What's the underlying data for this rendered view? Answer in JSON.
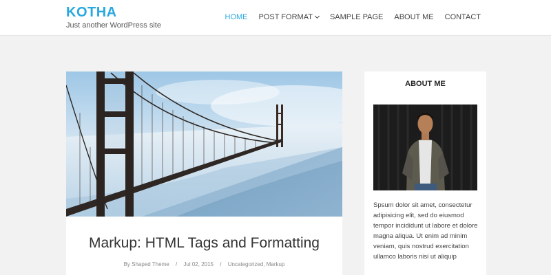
{
  "header": {
    "site_title": "KOTHA",
    "tagline": "Just another WordPress site",
    "nav": [
      {
        "label": "HOME",
        "active": true
      },
      {
        "label": "POST FORMAT",
        "dropdown": true
      },
      {
        "label": "SAMPLE PAGE"
      },
      {
        "label": "ABOUT ME"
      },
      {
        "label": "CONTACT"
      }
    ]
  },
  "post": {
    "title": "Markup: HTML Tags and Formatting",
    "author": "By Shaped Theme",
    "date": "Jul 02, 2015",
    "categories": "Uncategorized, Markup",
    "separator": "/"
  },
  "sidebar": {
    "widget_title": "ABOUT ME",
    "text": "Spsum dolor sit amet, consectetur adipisicing elit, sed do eiusmod tempor incididunt ut labore et dolore magna aliqua. Ut enim ad minim veniam, quis nostrud exercitation ullamco laboris nisi ut aliquip"
  },
  "colors": {
    "accent": "#29a8e0",
    "background": "#f2f2f2"
  }
}
